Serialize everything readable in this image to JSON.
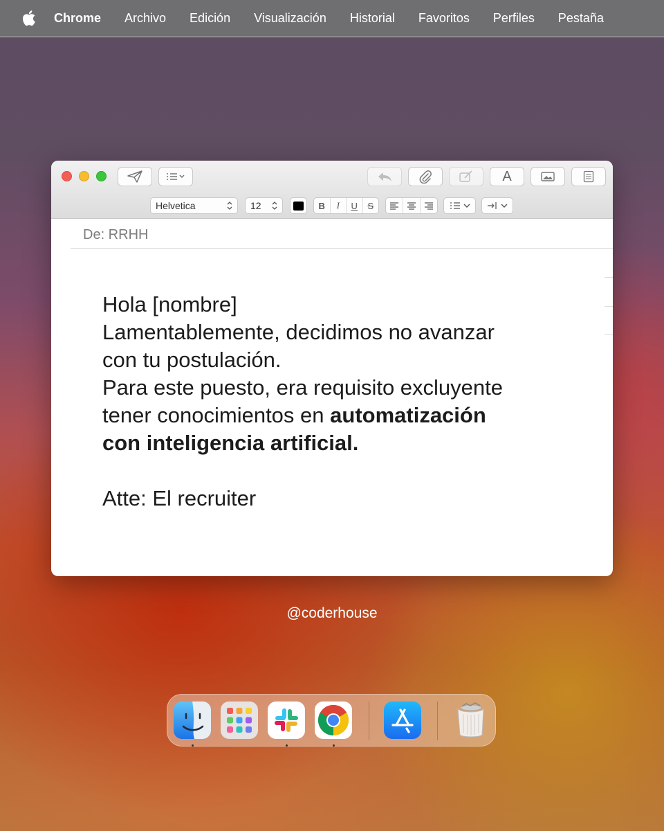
{
  "menubar": {
    "app_name": "Chrome",
    "items": [
      "Archivo",
      "Edición",
      "Visualización",
      "Historial",
      "Favoritos",
      "Perfiles",
      "Pestaña"
    ]
  },
  "mail": {
    "format": {
      "font": "Helvetica",
      "size": "12",
      "color": "#000000"
    },
    "from_label": "De: RRHH",
    "body": {
      "greeting": "Hola [nombre]",
      "line1": "Lamentablemente, decidimos no avanzar",
      "line2": "con tu postulación.",
      "line3": "Para este puesto, era requisito excluyente",
      "line4_plain": "tener conocimientos en ",
      "line4_bold": "automatización",
      "line5_bold": "con inteligencia artificial.",
      "signature": "Atte: El recruiter"
    }
  },
  "watermark": "@coderhouse",
  "dock": {
    "apps": [
      "finder-icon",
      "launchpad-icon",
      "slack-icon",
      "chrome-icon",
      "app-store-icon",
      "trash-icon"
    ]
  }
}
